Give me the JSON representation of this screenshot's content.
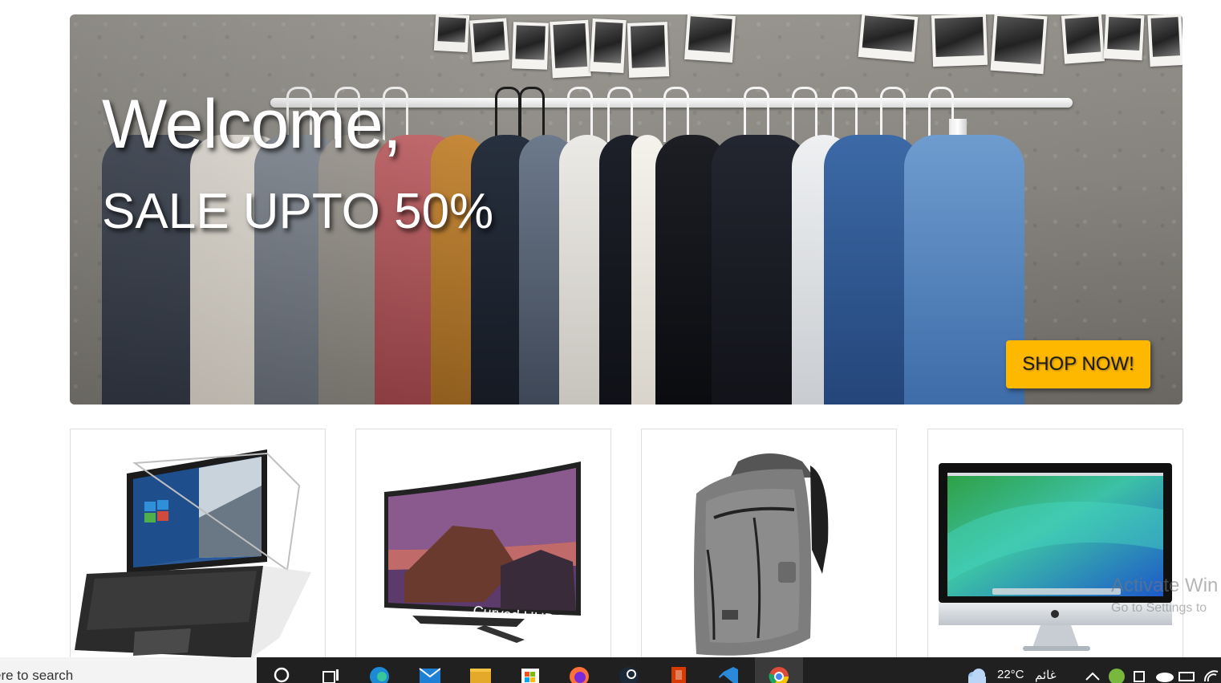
{
  "hero": {
    "title": "Welcome,",
    "subtitle": "SALE UPTO 50%",
    "cta_label": "SHOP NOW!",
    "cta_color": "#ffb800"
  },
  "products": [
    {
      "name": "laptop-2in1",
      "icon": "laptop-image"
    },
    {
      "name": "curved-tv",
      "icon": "tv-image",
      "overlay_text": "Curved UHD TV"
    },
    {
      "name": "backpack",
      "icon": "backpack-image"
    },
    {
      "name": "imac",
      "icon": "desktop-computer-image"
    }
  ],
  "watermark": {
    "title": "Activate Win",
    "subtitle": "Go to Settings to"
  },
  "taskbar": {
    "search_text": "ere to search",
    "apps": [
      "search-icon",
      "task-view-icon",
      "edge-icon",
      "mail-icon",
      "file-explorer-icon",
      "store-icon",
      "firefox-icon",
      "steam-icon",
      "office-icon",
      "vscode-icon",
      "chrome-icon"
    ],
    "weather_temp": "22°C",
    "weather_desc": "غائم"
  }
}
